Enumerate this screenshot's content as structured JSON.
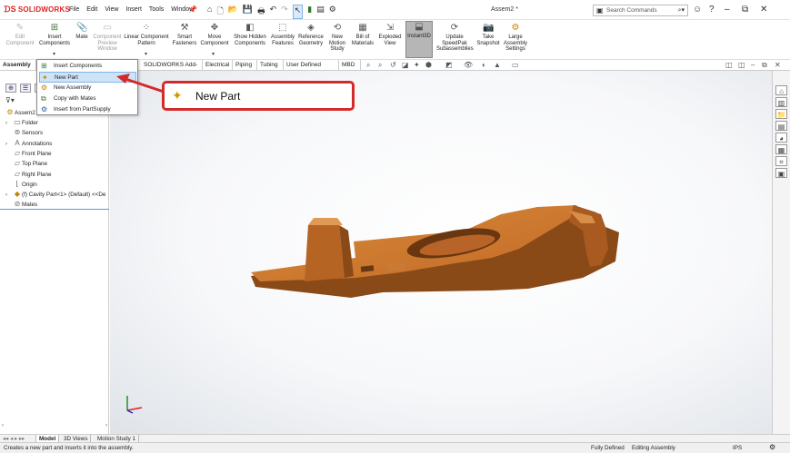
{
  "titlebar": {
    "logo_text": "SOLIDWORKS",
    "menus": [
      "File",
      "Edit",
      "View",
      "Insert",
      "Tools",
      "Window"
    ],
    "doc_title": "Assem2 *",
    "search_placeholder": "Search Commands"
  },
  "ribbon": {
    "edit_component": "Edit Component",
    "insert_components": "Insert Components",
    "mate": "Mate",
    "component_preview": "Component Preview Window",
    "linear_pattern": "Linear Component Pattern",
    "smart_fasteners": "Smart Fasteners",
    "move_component": "Move Component",
    "show_hidden": "Show Hidden Components",
    "assembly_features": "Assembly Features",
    "reference_geometry": "Reference Geometry",
    "new_motion_study": "New Motion Study",
    "bill_of_materials": "Bill of Materials",
    "exploded_view": "Exploded View",
    "instant3d": "Instant3D",
    "update_speedpak": "Update SpeedPak Subassemblies",
    "take_snapshot": "Take Snapshot",
    "large_assembly": "Large Assembly Settings"
  },
  "tabs": [
    "Assembly",
    "SOLIDWORKS Add-Ins",
    "Electrical",
    "Piping",
    "Tubing",
    "User Defined Route",
    "MBD"
  ],
  "dropdown": {
    "items": [
      "Insert Components",
      "New Part",
      "New Assembly",
      "Copy with Mates",
      "Insert from PartSupply"
    ]
  },
  "callout": {
    "label": "New Part"
  },
  "tree": {
    "root": "Assem2 (",
    "items": [
      "Folder",
      "Sensors",
      "Annotations",
      "Front Plane",
      "Top Plane",
      "Right Plane",
      "Origin",
      "(f) Cavity Part<1> (Default) <<De",
      "Mates"
    ]
  },
  "bottom_tabs": [
    "Model",
    "3D Views",
    "Motion Study 1"
  ],
  "status": {
    "hint": "Creates a new part and inserts it into the assembly.",
    "defined": "Fully Defined",
    "mode": "Editing Assembly",
    "units": "IPS"
  },
  "colors": {
    "part": "#c8742c",
    "part_dark": "#8a4a18",
    "accent_red": "#d42a2a",
    "highlight": "#cfe3f7"
  }
}
